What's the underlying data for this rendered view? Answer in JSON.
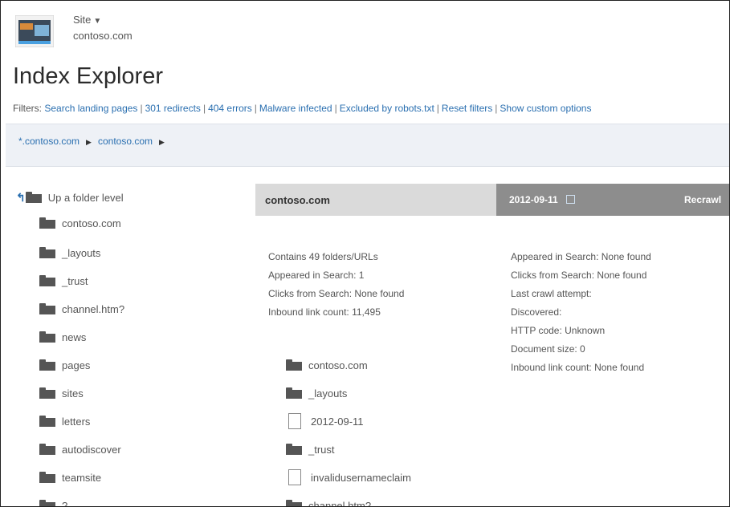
{
  "header": {
    "site_label": "Site",
    "site_url": "contoso.com",
    "title": "Index Explorer"
  },
  "filters": {
    "label": "Filters:",
    "links": [
      "Search landing pages",
      "301 redirects",
      "404 errors",
      "Malware infected",
      "Excluded by robots.txt",
      "Reset filters",
      "Show custom options"
    ]
  },
  "breadcrumb": [
    "*.contoso.com",
    "contoso.com"
  ],
  "tree": {
    "up_label": "Up a folder level",
    "items": [
      "contoso.com",
      "_layouts",
      "_trust",
      "channel.htm?",
      "news",
      "pages",
      "sites",
      "letters",
      "autodiscover",
      "teamsite",
      "?"
    ]
  },
  "folder_panel": {
    "title": "contoso.com",
    "stats": [
      "Contains 49 folders/URLs",
      "Appeared in Search: 1",
      "Clicks from Search: None found",
      "Inbound link count: 11,495"
    ],
    "children": [
      {
        "name": "contoso.com",
        "icon": "folder-icon"
      },
      {
        "name": "_layouts",
        "icon": "folder-icon"
      },
      {
        "name": "2012-09-11",
        "icon": "document-icon"
      },
      {
        "name": "_trust",
        "icon": "folder-icon"
      },
      {
        "name": "invalidusernameclaim",
        "icon": "document-icon"
      },
      {
        "name": "channel.htm?",
        "icon": "folder-icon"
      }
    ]
  },
  "detail_panel": {
    "title": "2012-09-11",
    "recrawl_label": "Recrawl",
    "stats": [
      "Appeared in Search: None found",
      "Clicks from Search: None found",
      "Last crawl attempt:",
      "Discovered:",
      "HTTP code: Unknown",
      "Document size: 0",
      "Inbound link count: None found"
    ]
  },
  "colors": {
    "link": "#2a6fb0",
    "breadcrumb_bg": "#eef1f6",
    "folder_header_bg": "#dadada",
    "detail_header_bg": "#8d8d8d"
  }
}
